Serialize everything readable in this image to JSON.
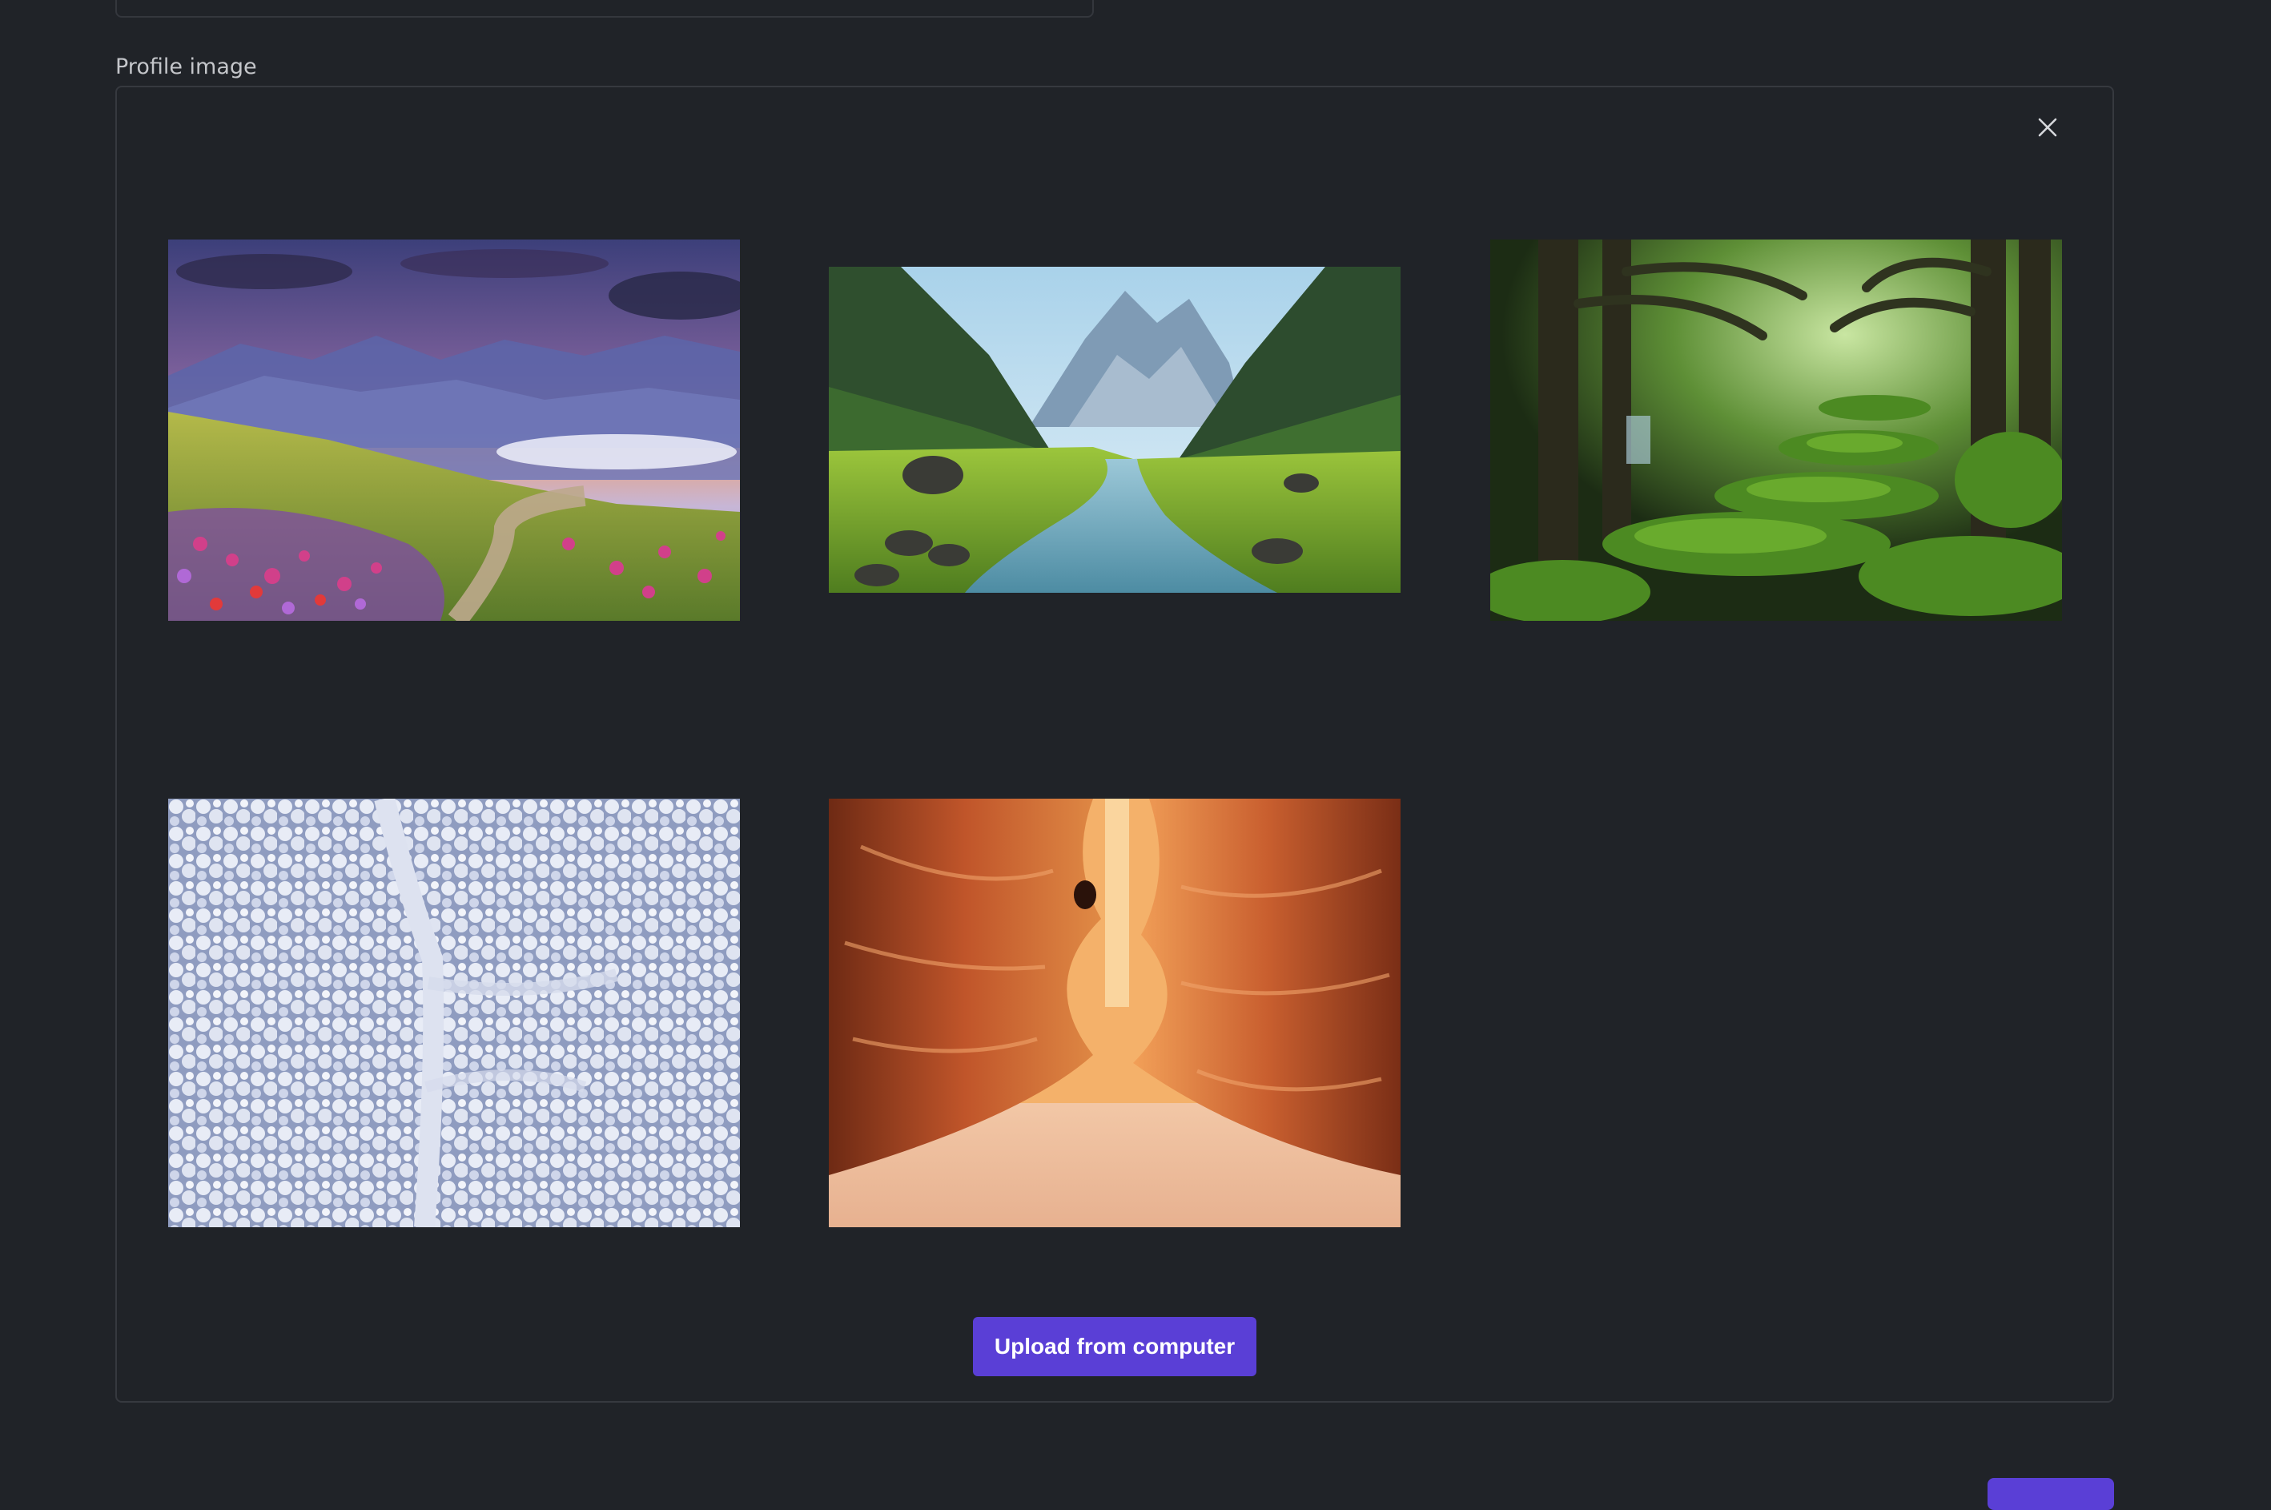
{
  "profile_image": {
    "label": "Profile image",
    "close_icon": "close-icon",
    "upload_label": "Upload from computer"
  },
  "gallery": [
    {
      "id": "mountain-meadow",
      "subject": "flower meadow with winding path and mountains at sunset"
    },
    {
      "id": "mountain-river",
      "subject": "green valley with stream and mountain peaks"
    },
    {
      "id": "mossy-forest",
      "subject": "moss-covered stone steps in green forest"
    },
    {
      "id": "snowy-forest",
      "subject": "aerial view of snow-covered forest with path"
    },
    {
      "id": "slot-canyon",
      "subject": "orange sandstone slot canyon"
    }
  ],
  "colors": {
    "background": "#202328",
    "panel_border": "#36393f",
    "accent": "#5a3fd6",
    "label_text": "#c4c6ca"
  }
}
